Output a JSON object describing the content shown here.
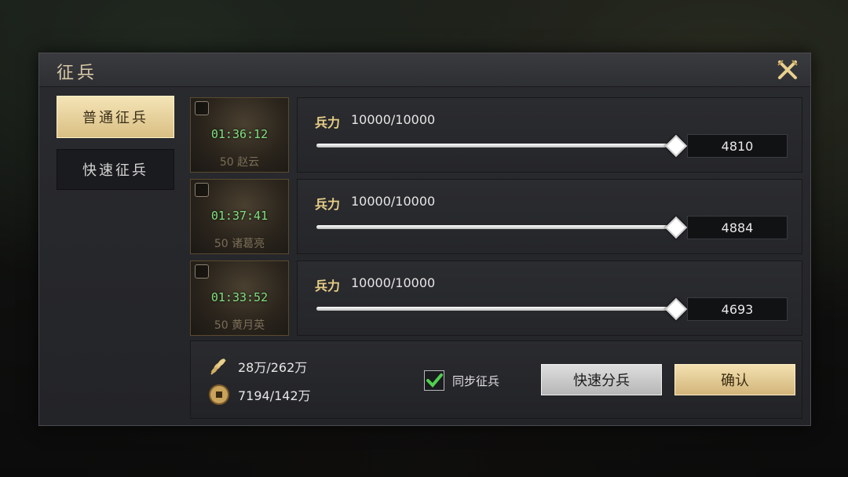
{
  "dialog": {
    "title": "征兵"
  },
  "tabs": [
    {
      "label": "普通征兵",
      "active": true
    },
    {
      "label": "快速征兵",
      "active": false
    }
  ],
  "rows": [
    {
      "timer": "01:36:12",
      "hero": "50 赵云",
      "troop_label": "兵力",
      "troop_value": "10000/10000",
      "slider_fraction": 0.995,
      "input_value": "4810"
    },
    {
      "timer": "01:37:41",
      "hero": "50 诸葛亮",
      "troop_label": "兵力",
      "troop_value": "10000/10000",
      "slider_fraction": 0.995,
      "input_value": "4884"
    },
    {
      "timer": "01:33:52",
      "hero": "50 黄月英",
      "troop_label": "兵力",
      "troop_value": "10000/10000",
      "slider_fraction": 0.995,
      "input_value": "4693"
    }
  ],
  "resources": {
    "grain": "28万/262万",
    "coin": "7194/142万"
  },
  "sync": {
    "label": "同步征兵",
    "checked": true
  },
  "buttons": {
    "quick_split": "快速分兵",
    "confirm": "确认"
  },
  "colors": {
    "gold_accent": "#d9bf83",
    "timer_green": "#7fe07f",
    "check_green": "#4fd14f"
  },
  "icons": {
    "close": "close-icon",
    "grain": "wheat-icon",
    "coin": "coin-icon",
    "check": "checkmark-icon"
  }
}
